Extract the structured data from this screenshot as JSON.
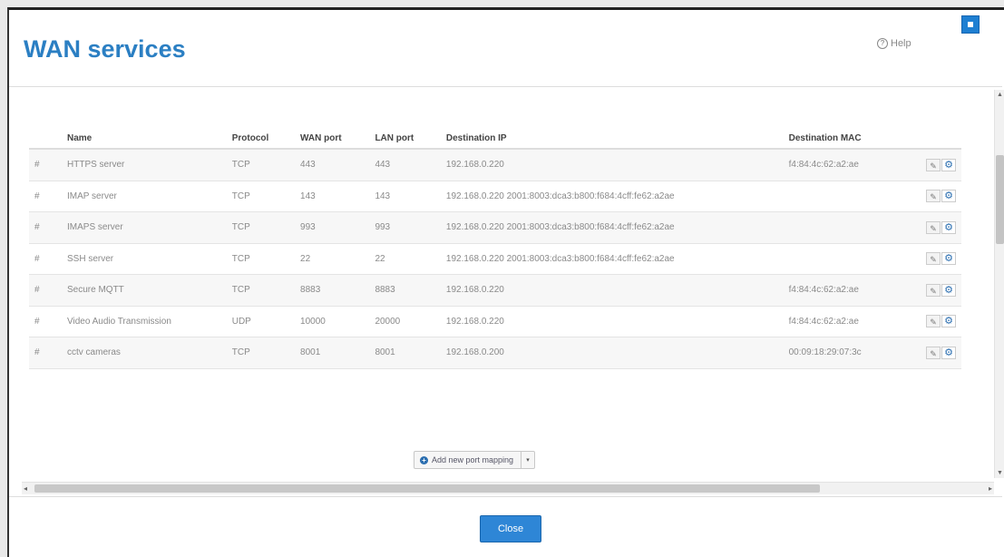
{
  "dialog": {
    "title": "WAN services",
    "help_label": "Help",
    "close_label": "Close"
  },
  "table": {
    "columns": [
      "Name",
      "Protocol",
      "WAN port",
      "LAN port",
      "Destination IP",
      "Destination MAC"
    ],
    "rows": [
      {
        "num": "#",
        "name": "HTTPS server",
        "protocol": "TCP",
        "wan_port": "443",
        "lan_port": "443",
        "dest_ip": "192.168.0.220",
        "dest_mac": "f4:84:4c:62:a2:ae"
      },
      {
        "num": "#",
        "name": "IMAP server",
        "protocol": "TCP",
        "wan_port": "143",
        "lan_port": "143",
        "dest_ip": "192.168.0.220 2001:8003:dca3:b800:f684:4cff:fe62:a2ae",
        "dest_mac": ""
      },
      {
        "num": "#",
        "name": "IMAPS server",
        "protocol": "TCP",
        "wan_port": "993",
        "lan_port": "993",
        "dest_ip": "192.168.0.220 2001:8003:dca3:b800:f684:4cff:fe62:a2ae",
        "dest_mac": ""
      },
      {
        "num": "#",
        "name": "SSH server",
        "protocol": "TCP",
        "wan_port": "22",
        "lan_port": "22",
        "dest_ip": "192.168.0.220 2001:8003:dca3:b800:f684:4cff:fe62:a2ae",
        "dest_mac": ""
      },
      {
        "num": "#",
        "name": "Secure MQTT",
        "protocol": "TCP",
        "wan_port": "8883",
        "lan_port": "8883",
        "dest_ip": "192.168.0.220",
        "dest_mac": "f4:84:4c:62:a2:ae"
      },
      {
        "num": "#",
        "name": "Video Audio Transmission",
        "protocol": "UDP",
        "wan_port": "10000",
        "lan_port": "20000",
        "dest_ip": "192.168.0.220",
        "dest_mac": "f4:84:4c:62:a2:ae"
      },
      {
        "num": "#",
        "name": "cctv cameras",
        "protocol": "TCP",
        "wan_port": "8001",
        "lan_port": "8001",
        "dest_ip": "192.168.0.200",
        "dest_mac": "00:09:18:29:07:3c"
      }
    ]
  },
  "add_mapping": {
    "label": "Add new port mapping",
    "caret": "▾"
  },
  "colors": {
    "title": "#2b7fc3",
    "primary_button": "#2e86d6"
  },
  "icons": {
    "help": "question-circle-icon",
    "edit": "edit-icon",
    "settings": "gear-icon",
    "add": "plus-circle-icon",
    "window": "window-control-icon"
  }
}
